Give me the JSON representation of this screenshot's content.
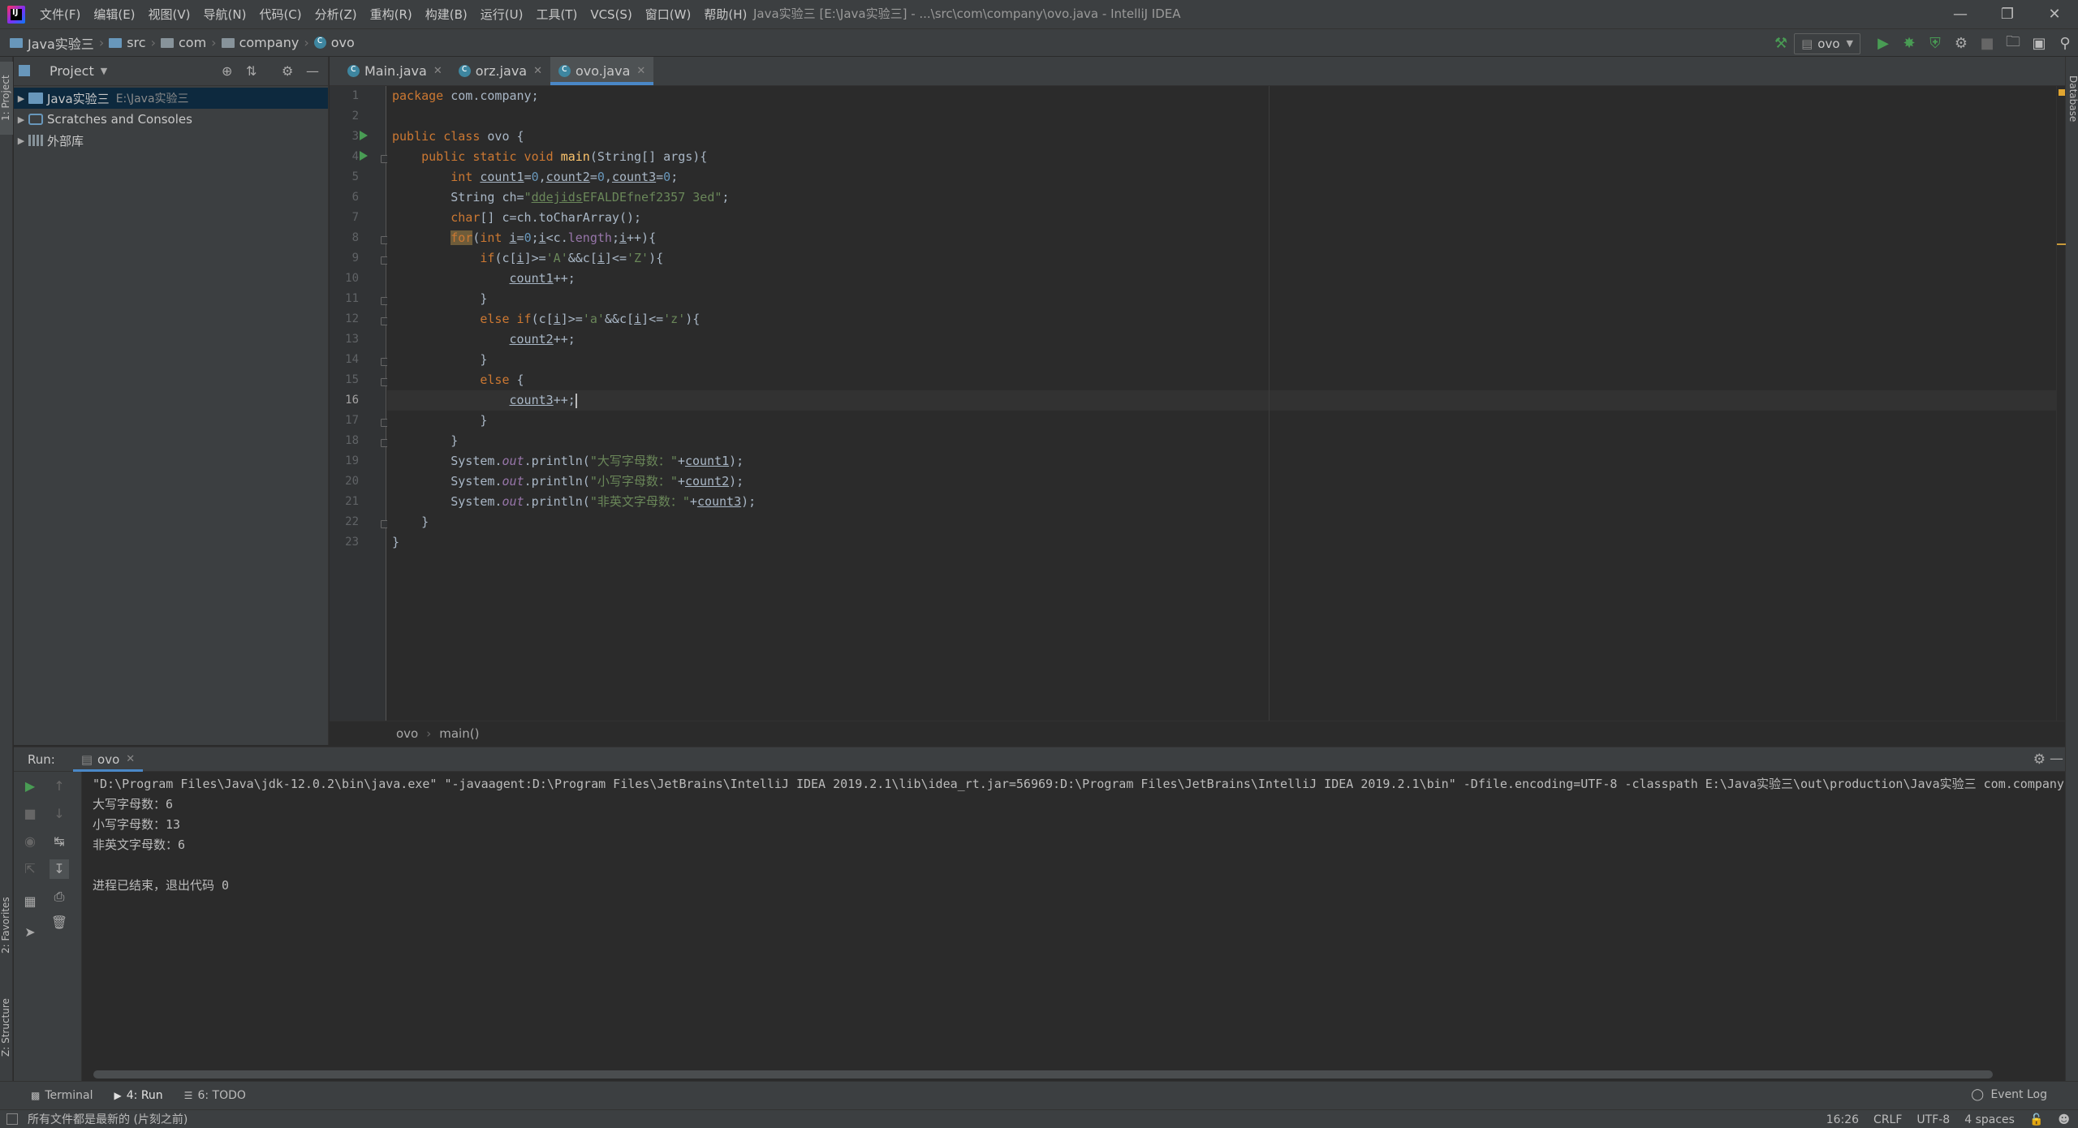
{
  "window": {
    "title": "Java实验三 [E:\\Java实验三] - ...\\src\\com\\company\\ovo.java - IntelliJ IDEA",
    "logo_text": "IJ"
  },
  "menu": [
    "文件(F)",
    "编辑(E)",
    "视图(V)",
    "导航(N)",
    "代码(C)",
    "分析(Z)",
    "重构(R)",
    "构建(B)",
    "运行(U)",
    "工具(T)",
    "VCS(S)",
    "窗口(W)",
    "帮助(H)"
  ],
  "navbar": {
    "crumbs": [
      "Java实验三",
      "src",
      "com",
      "company",
      "ovo"
    ],
    "run_config": "ovo"
  },
  "stripes": {
    "project": "1: Project",
    "favorites": "2: Favorites",
    "structure": "Z: Structure",
    "database": "Database"
  },
  "project_panel": {
    "title": "Project",
    "tree": [
      {
        "label": "Java实验三",
        "sub": "E:\\Java实验三"
      },
      {
        "label": "Scratches and Consoles",
        "sub": ""
      },
      {
        "label": "外部库",
        "sub": ""
      }
    ]
  },
  "editor": {
    "tabs": [
      "Main.java",
      "orz.java",
      "ovo.java"
    ],
    "active_tab": 2,
    "current_line": 16,
    "breadcrumb": [
      "ovo",
      "main()"
    ]
  },
  "run": {
    "label": "Run:",
    "tab": "ovo",
    "console": [
      "\"D:\\Program Files\\Java\\jdk-12.0.2\\bin\\java.exe\" \"-javaagent:D:\\Program Files\\JetBrains\\IntelliJ IDEA 2019.2.1\\lib\\idea_rt.jar=56969:D:\\Program Files\\JetBrains\\IntelliJ IDEA 2019.2.1\\bin\" -Dfile.encoding=UTF-8 -classpath E:\\Java实验三\\out\\production\\Java实验三 com.company.ovo",
      "大写字母数：6",
      "小写字母数：13",
      "非英文字母数：6",
      "",
      "进程已结束，退出代码 0"
    ]
  },
  "bottom_tabs": [
    "Terminal",
    "4: Run",
    "6: TODO"
  ],
  "event_log": "Event Log",
  "status": {
    "message": "所有文件都是最新的 (片刻之前)",
    "position": "16:26",
    "line_sep": "CRLF",
    "encoding": "UTF-8",
    "indent": "4 spaces"
  },
  "colors": {
    "background": "#2b2b2b",
    "panel": "#3c3f41",
    "keyword": "#cc7832",
    "string": "#6a8759",
    "number": "#6897bb",
    "method": "#ffc66d",
    "field": "#9876aa",
    "accent": "#4a88c7",
    "run_green": "#499c54"
  }
}
